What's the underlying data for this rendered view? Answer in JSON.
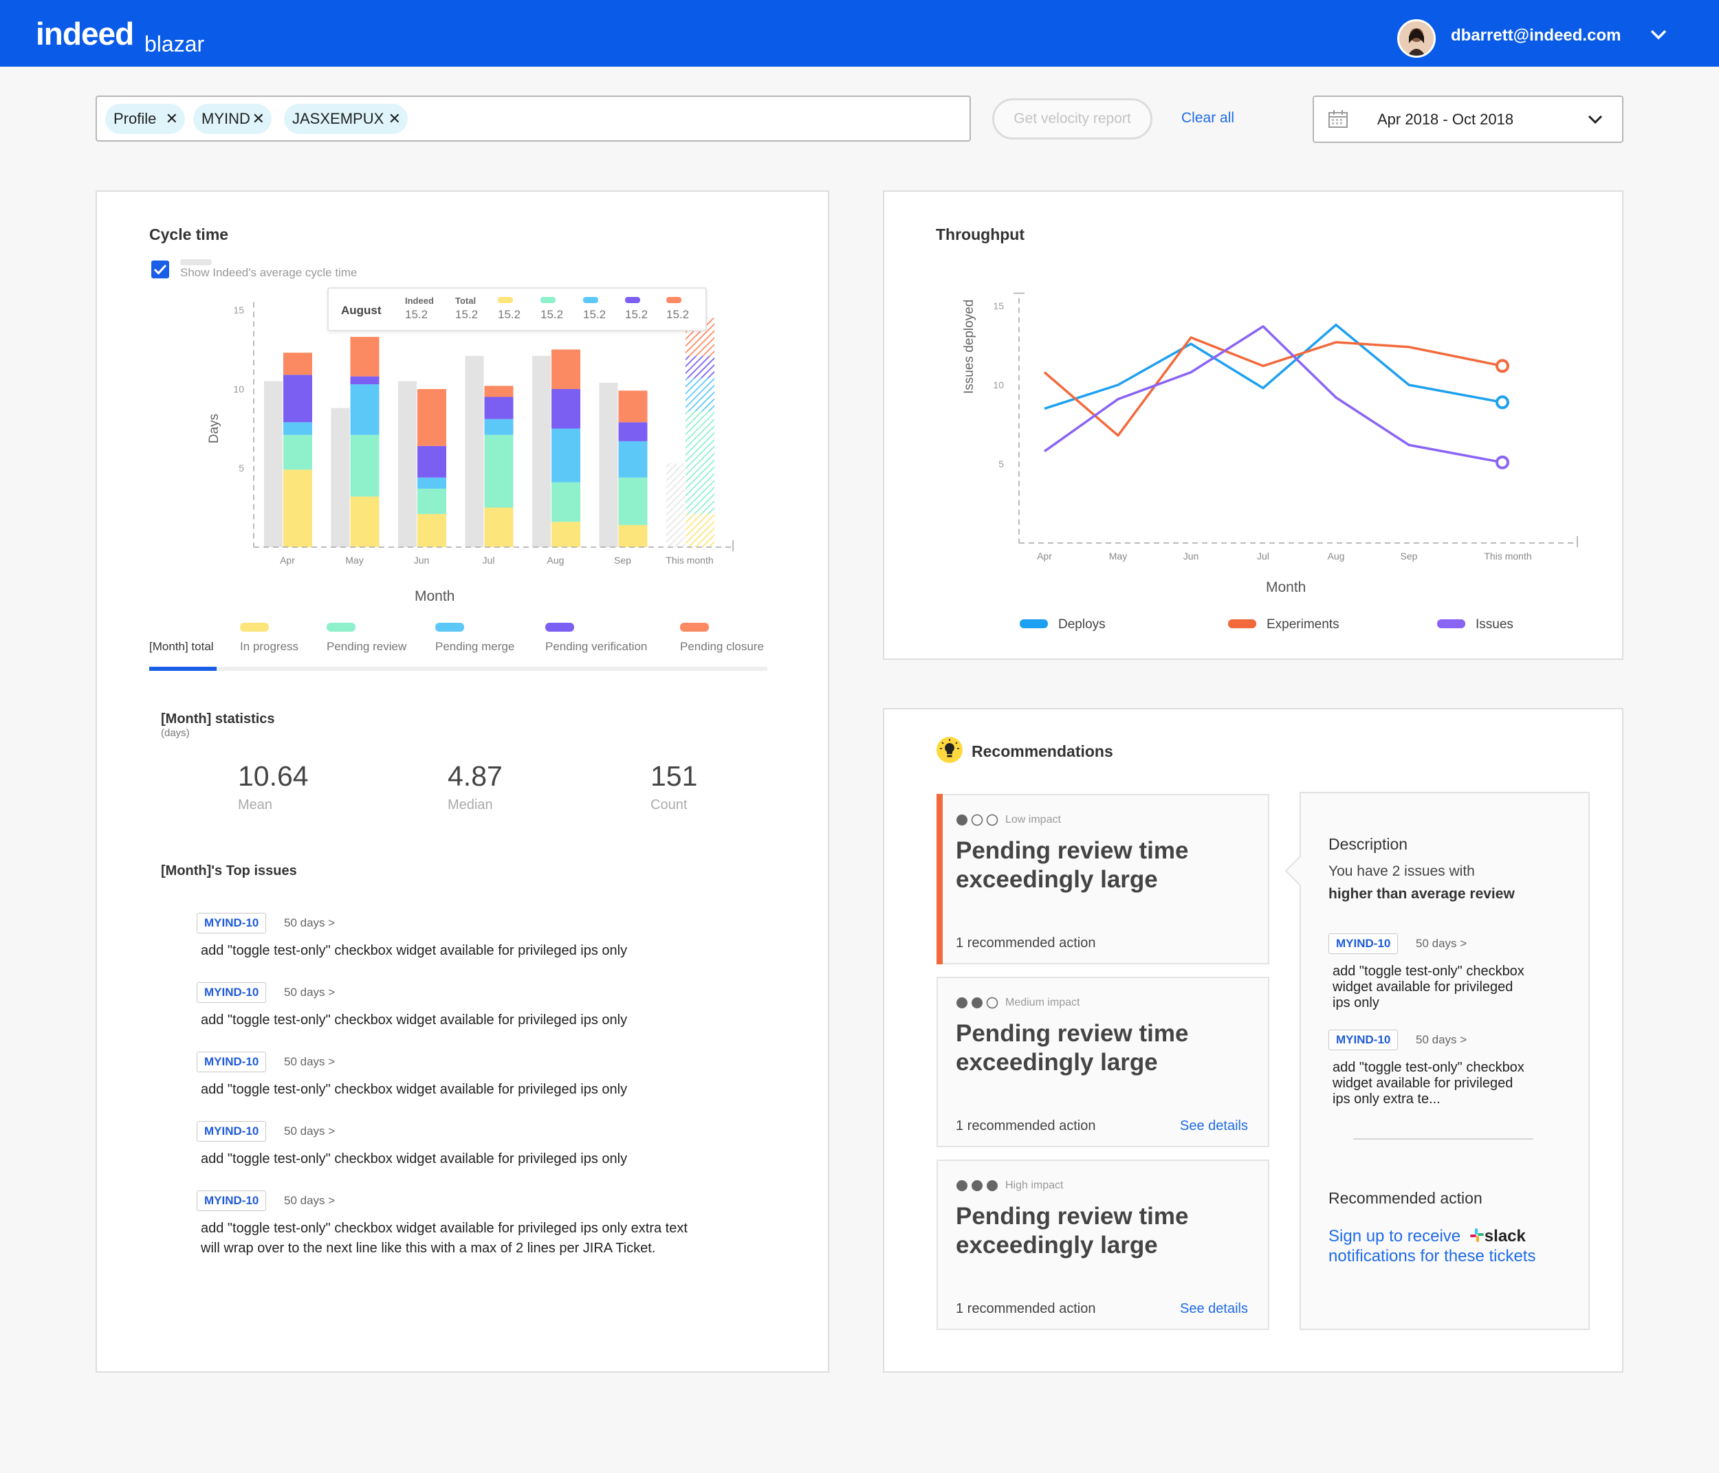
{
  "app": {
    "brand": "indeed",
    "product": "blazar",
    "user_email": "dbarrett@indeed.com"
  },
  "filters": {
    "chips": [
      "Profile",
      "MYIND",
      "JASXEMPUX"
    ],
    "velocity_button": "Get velocity report",
    "clear_all": "Clear all",
    "date_range": "Apr 2018 - Oct 2018"
  },
  "cycle_time": {
    "title": "Cycle time",
    "checkbox_label": "Show Indeed's average cycle time",
    "tooltip": {
      "month": "August",
      "indeed_label": "Indeed",
      "total_label": "Total",
      "values": [
        "15.2",
        "15.2",
        "15.2",
        "15.2",
        "15.2",
        "15.2",
        "15.2"
      ]
    },
    "tabs": [
      "[Month] total",
      "In progress",
      "Pending review",
      "Pending merge",
      "Pending verification",
      "Pending closure"
    ],
    "statistics_title": "[Month] statistics",
    "statistics_unit": "(days)",
    "stats": [
      {
        "value": "10.64",
        "label": "Mean"
      },
      {
        "value": "4.87",
        "label": "Median"
      },
      {
        "value": "151",
        "label": "Count"
      }
    ],
    "top_issues_title": "[Month]'s Top issues",
    "issues": [
      {
        "key": "MYIND-10",
        "age": "50 days >",
        "text": "add \"toggle test-only\" checkbox widget available for privileged ips only"
      },
      {
        "key": "MYIND-10",
        "age": "50 days >",
        "text": "add \"toggle test-only\" checkbox widget available for privileged ips only"
      },
      {
        "key": "MYIND-10",
        "age": "50 days >",
        "text": "add \"toggle test-only\" checkbox widget available for privileged ips only"
      },
      {
        "key": "MYIND-10",
        "age": "50 days >",
        "text": "add \"toggle test-only\" checkbox widget available for privileged ips only"
      },
      {
        "key": "MYIND-10",
        "age": "50 days >",
        "text": "add \"toggle test-only\" checkbox widget available for privileged ips only extra text",
        "text2": "will wrap over to the next line like this with a max of 2 lines per JIRA Ticket."
      }
    ]
  },
  "chart_data": [
    {
      "type": "bar",
      "title": "Cycle time",
      "xlabel": "Month",
      "ylabel": "Days",
      "ylim": [
        0,
        16
      ],
      "yticks": [
        5,
        10,
        15
      ],
      "categories": [
        "Apr",
        "May",
        "Jun",
        "Jul",
        "Aug",
        "Sep",
        "This month"
      ],
      "indeed_average": [
        10.5,
        8.8,
        10.5,
        12.1,
        12.1,
        10.4,
        5.3
      ],
      "series": [
        {
          "name": "In progress",
          "color": "#fce57a",
          "values": [
            4.9,
            3.2,
            2.1,
            2.5,
            1.6,
            1.4,
            2.1
          ]
        },
        {
          "name": "Pending review",
          "color": "#8ff0cc",
          "values": [
            2.2,
            3.9,
            1.6,
            4.6,
            2.5,
            3.0,
            6.5
          ]
        },
        {
          "name": "Pending merge",
          "color": "#5cc8f8",
          "values": [
            0.8,
            3.2,
            0.7,
            1.0,
            3.4,
            2.3,
            2.1
          ]
        },
        {
          "name": "Pending verification",
          "color": "#7b5ff2",
          "values": [
            3.0,
            0.5,
            2.0,
            1.4,
            2.5,
            1.2,
            1.4
          ]
        },
        {
          "name": "Pending closure",
          "color": "#fb8a62",
          "values": [
            1.4,
            2.5,
            3.6,
            0.7,
            2.5,
            2.0,
            2.4
          ]
        }
      ]
    },
    {
      "type": "line",
      "title": "Throughput",
      "xlabel": "Month",
      "ylabel": "Issues deployed",
      "ylim": [
        0,
        16
      ],
      "yticks": [
        5,
        10,
        15
      ],
      "x": [
        "Apr",
        "May",
        "Jun",
        "Jul",
        "Aug",
        "Sep",
        "This month"
      ],
      "series": [
        {
          "name": "Deploys",
          "color": "#1ea0f0",
          "values": [
            8.5,
            10.0,
            12.6,
            9.8,
            13.8,
            10.0,
            8.9
          ]
        },
        {
          "name": "Experiments",
          "color": "#f26a3c",
          "values": [
            10.8,
            6.8,
            13.0,
            11.2,
            12.7,
            12.4,
            11.2
          ]
        },
        {
          "name": "Issues",
          "color": "#8a64f5",
          "values": [
            5.8,
            9.1,
            10.8,
            13.7,
            9.2,
            6.2,
            5.1
          ]
        }
      ]
    }
  ],
  "throughput": {
    "title": "Throughput",
    "legend": [
      "Deploys",
      "Experiments",
      "Issues"
    ]
  },
  "recommendations": {
    "title": "Recommendations",
    "items": [
      {
        "impact": "Low impact",
        "level": 1,
        "title1": "Pending review time",
        "title2": "exceedingly large",
        "action": "1 recommended action",
        "details": ""
      },
      {
        "impact": "Medium impact",
        "level": 2,
        "title1": "Pending review time",
        "title2": "exceedingly large",
        "action": "1 recommended action",
        "details": "See details"
      },
      {
        "impact": "High impact",
        "level": 3,
        "title1": "Pending review time",
        "title2": "exceedingly large",
        "action": "1 recommended action",
        "details": "See details"
      }
    ],
    "detail": {
      "description_label": "Description",
      "description_text": "You have 2 issues with",
      "description_bold": "higher than average review",
      "issues": [
        {
          "key": "MYIND-10",
          "age": "50 days >",
          "lines": [
            "add \"toggle test-only\" checkbox",
            "widget available for privileged",
            "ips only"
          ]
        },
        {
          "key": "MYIND-10",
          "age": "50 days >",
          "lines": [
            "add \"toggle test-only\" checkbox",
            "widget available for privileged",
            "ips only extra te..."
          ]
        }
      ],
      "action_label": "Recommended action",
      "action_link1": "Sign up to receive",
      "slack": "slack",
      "action_link2": "notifications for these tickets"
    }
  }
}
